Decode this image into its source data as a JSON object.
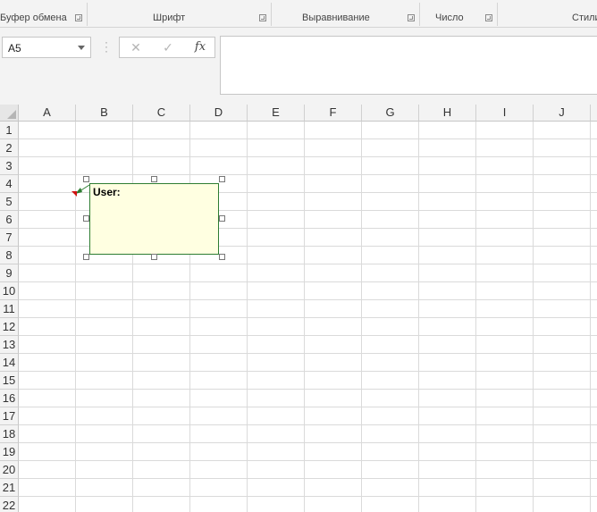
{
  "ribbon": {
    "groups": [
      {
        "label": "Буфер обмена",
        "launcher": true
      },
      {
        "label": "Шрифт",
        "launcher": true
      },
      {
        "label": "Выравнивание",
        "launcher": true
      },
      {
        "label": "Число",
        "launcher": true
      },
      {
        "label": "Стили",
        "launcher": false
      }
    ]
  },
  "formula_bar": {
    "name_box": "A5",
    "cancel_icon": "✕",
    "enter_icon": "✓",
    "fx_label": "fx",
    "formula": ""
  },
  "sheet": {
    "columns": [
      "A",
      "B",
      "C",
      "D",
      "E",
      "F",
      "G",
      "H",
      "I",
      "J"
    ],
    "rows": [
      "1",
      "2",
      "3",
      "4",
      "5",
      "6",
      "7",
      "8",
      "9",
      "10",
      "11",
      "12",
      "13",
      "14",
      "15",
      "16",
      "17",
      "18",
      "19",
      "20",
      "21",
      "22"
    ]
  },
  "comment": {
    "author": "User:",
    "text": "",
    "background": "#ffffe1",
    "border_color": "#2e7d32",
    "indicator_color": "#d01010"
  }
}
